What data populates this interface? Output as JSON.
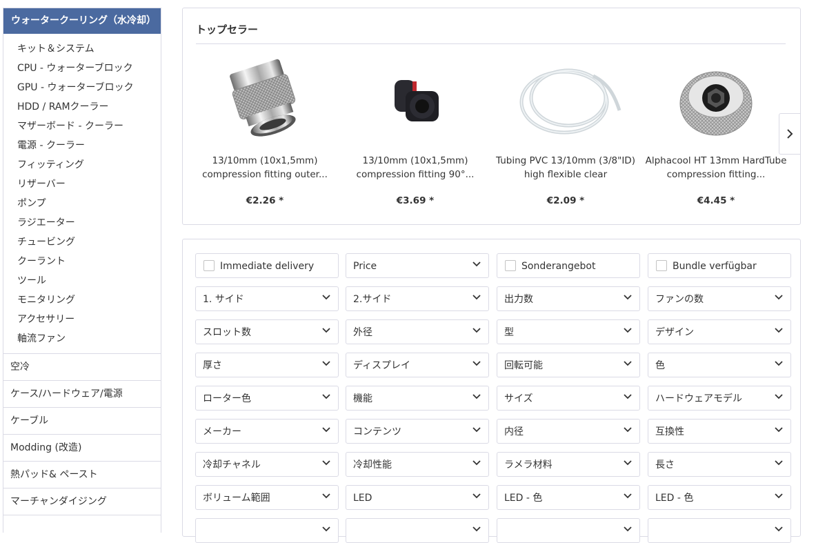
{
  "sidebar": {
    "active_category": "ウォータークーリング（水冷却）",
    "subcategories": [
      "キット＆システム",
      "CPU - ウォーターブロック",
      "GPU - ウォーターブロック",
      "HDD / RAMクーラー",
      "マザーボード - クーラー",
      "電源 - クーラー",
      "フィッティング",
      "リザーバー",
      "ポンプ",
      "ラジエーター",
      "チュービング",
      "クーラント",
      "ツール",
      "モニタリング",
      "アクセサリー",
      "軸流ファン"
    ],
    "categories": [
      "空冷",
      "ケース/ハードウェア/電源",
      "ケーブル",
      "Modding (改造)",
      "熱パッド& ペースト",
      "マーチャンダイジング"
    ]
  },
  "topsellers": {
    "title": "トップセラー",
    "products": [
      {
        "name": "13/10mm (10x1,5mm) compression fitting outer...",
        "price": "€2.26 *"
      },
      {
        "name": "13/10mm (10x1,5mm) compression fitting 90°...",
        "price": "€3.69 *"
      },
      {
        "name": "Tubing PVC 13/10mm (3/8\"ID) high flexible clear",
        "price": "€2.09 *"
      },
      {
        "name": "Alphacool HT 13mm HardTube compression fitting...",
        "price": "€4.45 *"
      }
    ]
  },
  "filters": [
    {
      "label": "Immediate delivery",
      "type": "checkbox"
    },
    {
      "label": "Price",
      "type": "dropdown"
    },
    {
      "label": "Sonderangebot",
      "type": "checkbox"
    },
    {
      "label": "Bundle verfügbar",
      "type": "checkbox"
    },
    {
      "label": "1. サイド",
      "type": "dropdown"
    },
    {
      "label": "2.サイド",
      "type": "dropdown"
    },
    {
      "label": "出力数",
      "type": "dropdown"
    },
    {
      "label": "ファンの数",
      "type": "dropdown"
    },
    {
      "label": "スロット数",
      "type": "dropdown"
    },
    {
      "label": "外径",
      "type": "dropdown"
    },
    {
      "label": "型",
      "type": "dropdown"
    },
    {
      "label": "デザイン",
      "type": "dropdown"
    },
    {
      "label": "厚さ",
      "type": "dropdown"
    },
    {
      "label": "ディスプレイ",
      "type": "dropdown"
    },
    {
      "label": "回転可能",
      "type": "dropdown"
    },
    {
      "label": "色",
      "type": "dropdown"
    },
    {
      "label": "ローター色",
      "type": "dropdown"
    },
    {
      "label": "機能",
      "type": "dropdown"
    },
    {
      "label": "サイズ",
      "type": "dropdown"
    },
    {
      "label": "ハードウェアモデル",
      "type": "dropdown"
    },
    {
      "label": "メーカー",
      "type": "dropdown"
    },
    {
      "label": "コンテンツ",
      "type": "dropdown"
    },
    {
      "label": "内径",
      "type": "dropdown"
    },
    {
      "label": "互換性",
      "type": "dropdown"
    },
    {
      "label": "冷却チャネル",
      "type": "dropdown"
    },
    {
      "label": "冷却性能",
      "type": "dropdown"
    },
    {
      "label": "ラメラ材料",
      "type": "dropdown"
    },
    {
      "label": "長さ",
      "type": "dropdown"
    },
    {
      "label": "ボリューム範囲",
      "type": "dropdown"
    },
    {
      "label": "LED",
      "type": "dropdown"
    },
    {
      "label": "LED -  色",
      "type": "dropdown"
    },
    {
      "label": "LED - 色",
      "type": "dropdown"
    },
    {
      "label": "",
      "type": "dropdown"
    },
    {
      "label": "",
      "type": "dropdown"
    },
    {
      "label": "",
      "type": "dropdown"
    },
    {
      "label": "",
      "type": "dropdown"
    }
  ],
  "icons": {
    "next": "chevron-right-icon",
    "dropdown": "chevron-down-icon"
  },
  "colors": {
    "accent": "#4b6aa0",
    "border": "#dadae5"
  }
}
